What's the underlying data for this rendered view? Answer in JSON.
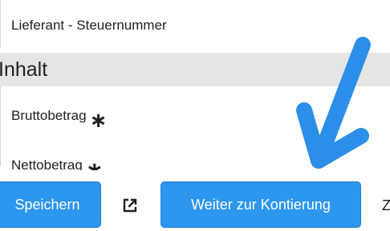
{
  "fields": {
    "supplier_tax_label": "Lieferant - Steuernummer",
    "gross_label": "Bruttobetrag",
    "net_label": "Nettobetrag",
    "required_mark": "∗"
  },
  "section": {
    "title": "Inhalt"
  },
  "footer": {
    "save_label": "Speichern",
    "next_label": "Weiter zur Kontierung",
    "truncated_label": "Z"
  },
  "colors": {
    "primary": "#2d96ee",
    "section_bg": "#e5e5e5",
    "arrow": "#2b8fe9"
  },
  "icons": {
    "external": "external-link-icon",
    "annotation": "arrow-annotation"
  }
}
